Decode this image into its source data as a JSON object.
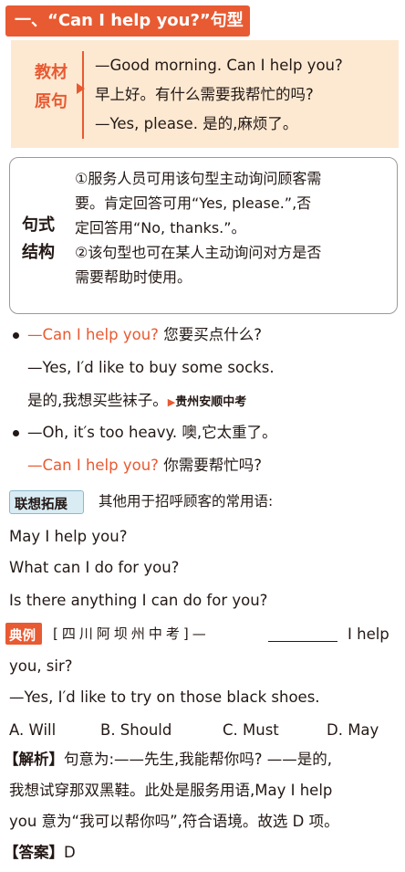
{
  "section_title": "一、“Can I help you?”句型",
  "original": {
    "label": [
      "教材",
      "原句"
    ],
    "lines": [
      "—Good morning. Can I help you?",
      "早上好。有什么需要我帮忙的吗?",
      "—Yes, please. 是的,麻烦了。"
    ]
  },
  "structure": {
    "label": [
      "句式",
      "结构"
    ],
    "lines": [
      "①服务人员可用该句型主动询问顾客需",
      "要。肯定回答可用“Yes, please.”,否",
      "定回答用“No, thanks.”。",
      "②该句型也可在某人主动询问对方是否",
      "需要帮助时使用。"
    ]
  },
  "examples": {
    "e1_q_en": "—Can I help you?",
    "e1_q_zh": "您要买点什么?",
    "e1_a_en": "—Yes, I′d like to buy some socks.",
    "e1_a_zh": "是的,我想买些袜子。",
    "e1_source": "贵州安顺中考",
    "e2_a": "—Oh, it′s too heavy. 噢,它太重了。",
    "e2_q_en": "—Can I help you?",
    "e2_q_zh": "你需要帮忙吗?"
  },
  "related": {
    "tag": "联想拓展",
    "intro": "其他用于招呼顾客的常用语:",
    "lines": [
      "May I help you?",
      "What can I do for you?",
      "Is there anything I can do for you?"
    ]
  },
  "exercise": {
    "tag": "典例",
    "source": "[四川阿坝州中考]—",
    "q_tail": "I help",
    "q_line2": "you, sir?",
    "answer_line": "—Yes, I′d like to try on those black shoes.",
    "options": [
      "A. Will",
      "B. Should",
      "C. Must",
      "D. May"
    ],
    "analysis_label": "【解析】",
    "analysis_lines": [
      "句意为:——先生,我能帮你吗? ——是的,",
      "我想试穿那双黑鞋。此处是服务用语,May I help",
      "you 意为“我可以帮你吗”,符合语境。故选 D 项。"
    ],
    "answer_label": "【答案】",
    "answer_value": "D"
  },
  "colors": {
    "accent": "#e85a32",
    "box_fill": "#fde9d2",
    "tag_fill": "#d9ecf4"
  }
}
